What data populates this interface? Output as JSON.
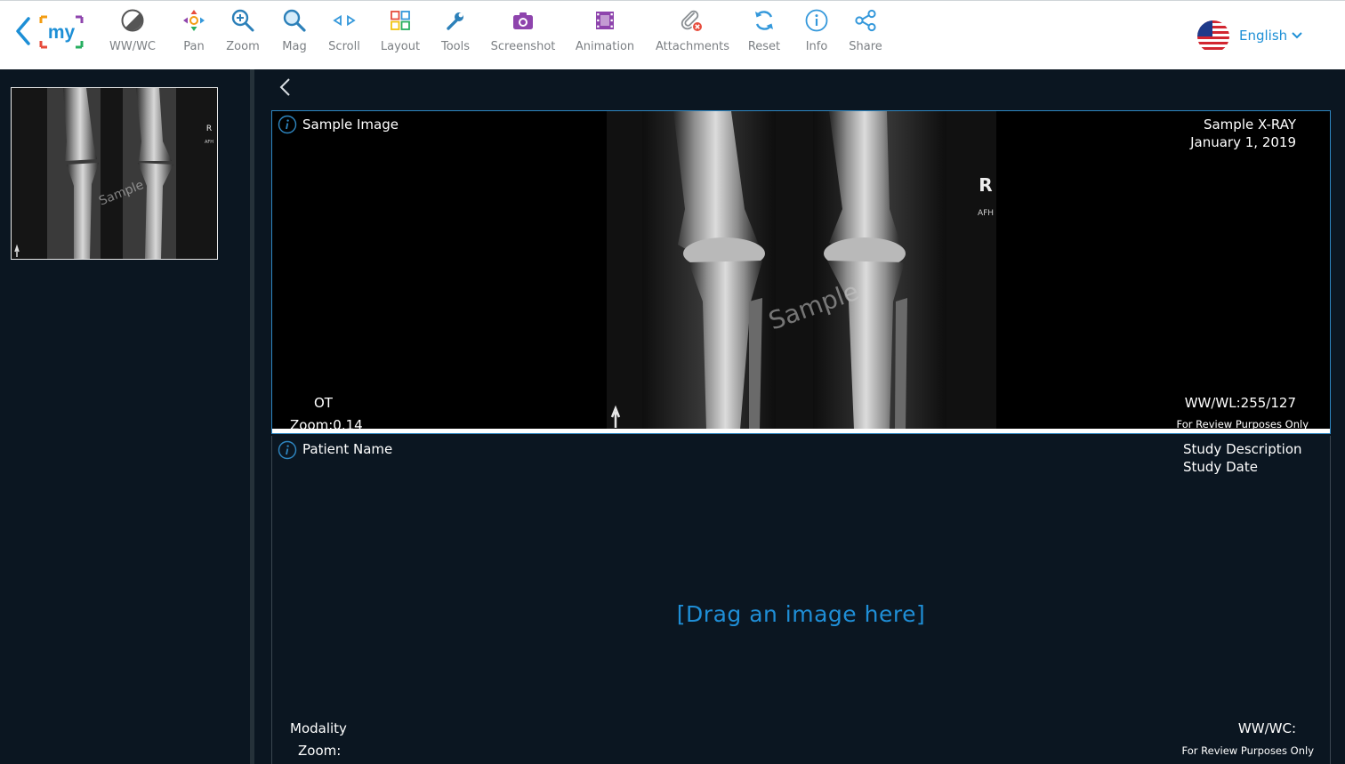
{
  "toolbar": {
    "tools": [
      {
        "id": "wwwc",
        "label": "WW/WC",
        "icon": "contrast-icon"
      },
      {
        "id": "pan",
        "label": "Pan",
        "icon": "pan-arrows-icon"
      },
      {
        "id": "zoom",
        "label": "Zoom",
        "icon": "zoom-icon"
      },
      {
        "id": "mag",
        "label": "Mag",
        "icon": "magnifier-icon"
      },
      {
        "id": "scroll",
        "label": "Scroll",
        "icon": "scroll-arrows-icon"
      },
      {
        "id": "layout",
        "label": "Layout",
        "icon": "layout-grid-icon"
      },
      {
        "id": "tools",
        "label": "Tools",
        "icon": "wrench-icon"
      },
      {
        "id": "screenshot",
        "label": "Screenshot",
        "icon": "camera-icon"
      },
      {
        "id": "animation",
        "label": "Animation",
        "icon": "film-icon"
      },
      {
        "id": "attachments",
        "label": "Attachments",
        "icon": "paperclip-icon"
      },
      {
        "id": "reset",
        "label": "Reset",
        "icon": "reset-icon"
      },
      {
        "id": "info",
        "label": "Info",
        "icon": "info-icon"
      },
      {
        "id": "share",
        "label": "Share",
        "icon": "share-icon"
      }
    ],
    "logo_text": "my",
    "language": "English"
  },
  "colors": {
    "accent": "#1d8fd6",
    "panel_bg": "#0b1621",
    "toolbar_bg": "#ffffff",
    "tool_label": "#7b7f83",
    "viewport_border": "#2e86c1",
    "screenshot_purple": "#8e44ad"
  },
  "viewport_active": {
    "info_title": "Sample Image",
    "study_description": "Sample X-RAY",
    "study_date": "January 1, 2019",
    "modality": "OT",
    "zoom": "Zoom:0.14",
    "wwwl": "WW/WL:255/127",
    "review_note": "For Review Purposes Only",
    "watermark": "Sample",
    "marker_side": "R",
    "marker_extra": "AFH"
  },
  "viewport_empty": {
    "patient_label": "Patient Name",
    "study_description_label": "Study Description",
    "study_date_label": "Study Date",
    "drag_prompt": "[Drag an image here]",
    "modality_label": "Modality",
    "zoom_label": "Zoom:",
    "wwwc_label": "WW/WC:",
    "review_note": "For Review Purposes Only"
  },
  "thumbnail": {
    "watermark": "Sample",
    "marker_side": "R",
    "marker_extra": "AFH"
  }
}
